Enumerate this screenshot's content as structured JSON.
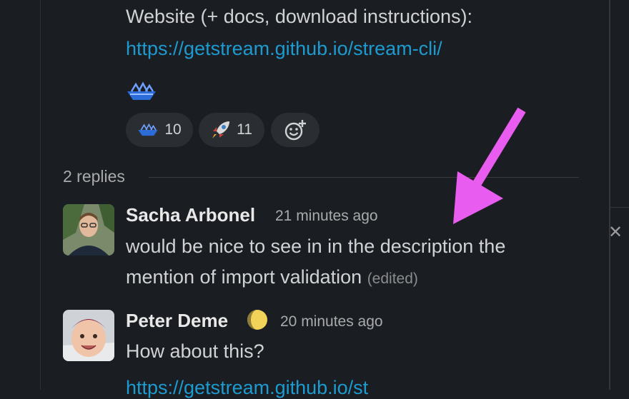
{
  "message": {
    "text_line": "Website (+ docs, download instructions):",
    "link": "https://getstream.github.io/stream-cli/",
    "reactions": [
      {
        "icon": "ship-emoji",
        "count": "10"
      },
      {
        "icon": "rocket-emoji",
        "count": "11"
      }
    ]
  },
  "thread": {
    "replies_label": "2 replies",
    "replies": [
      {
        "author": "Sacha Arbonel",
        "time": "21 minutes ago",
        "line1": "would be nice to see in in the description the",
        "line2": "mention of import validation",
        "edited": "(edited)"
      },
      {
        "author": "Peter Deme",
        "time": "20 minutes ago",
        "text": "How about this?",
        "link_partial": "https://getstream.github.io/st"
      }
    ]
  },
  "right_pane": {
    "close_glyph": "✕"
  },
  "colors": {
    "link": "#1d9bd1",
    "arrow": "#e95cf0",
    "background": "#1a1d21"
  }
}
